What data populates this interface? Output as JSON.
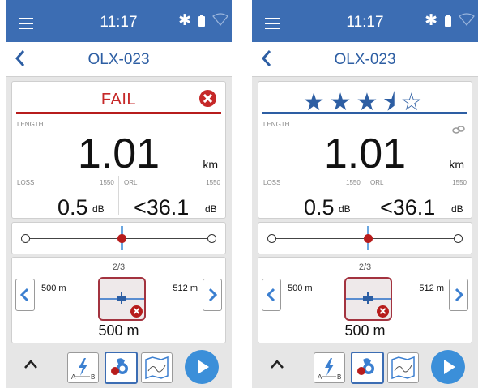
{
  "colors": {
    "primary": "#3c6db3",
    "fail": "#c62828",
    "accent": "#3b8fd9"
  },
  "screens": [
    {
      "status": {
        "time": "11:17",
        "bluetooth": "✱"
      },
      "header": {
        "title": "OLX-023"
      },
      "result": {
        "kind": "verdict",
        "text": "FAIL",
        "icon": "fail-x-icon"
      },
      "length": {
        "label": "LENGTH",
        "value": "1.01",
        "unit": "km"
      },
      "loss": {
        "label": "LOSS",
        "wavelength": "1550",
        "value": "0.5",
        "unit": "dB"
      },
      "orl": {
        "label": "ORL",
        "wavelength": "1550",
        "value": "<36.1",
        "unit": "dB"
      },
      "event": {
        "index": "2/3",
        "left_distance": "500 m",
        "right_distance": "512 m",
        "distance": "500 m",
        "icon": "connector-fail-icon"
      }
    },
    {
      "status": {
        "time": "11:17",
        "bluetooth": "✱"
      },
      "header": {
        "title": "OLX-023"
      },
      "result": {
        "kind": "rating",
        "stars": "★★★⯨☆",
        "rating": 3.5,
        "max": 5
      },
      "length": {
        "label": "LENGTH",
        "value": "1.01",
        "unit": "km"
      },
      "loss": {
        "label": "LOSS",
        "wavelength": "1550",
        "value": "0.5",
        "unit": "dB"
      },
      "orl": {
        "label": "ORL",
        "wavelength": "1550",
        "value": "<36.1",
        "unit": "dB"
      },
      "event": {
        "index": "2/3",
        "left_distance": "500 m",
        "right_distance": "512 m",
        "distance": "500 m",
        "icon": "connector-fail-icon"
      }
    }
  ],
  "toolbar": {
    "buttons": [
      "collapse-caret-icon",
      "ab-test-icon",
      "event-view-icon",
      "map-view-icon",
      "play-icon"
    ]
  }
}
